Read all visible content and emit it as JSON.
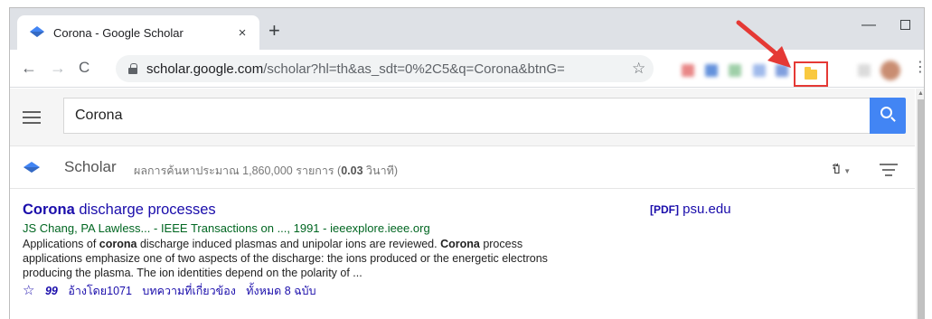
{
  "browser": {
    "tab_title": "Corona - Google Scholar",
    "tab_close": "×",
    "new_tab": "+",
    "url_host": "scholar.google.com",
    "url_path": "/scholar?hl=th&as_sdt=0%2C5&q=Corona&btnG=",
    "back": "←",
    "forward": "→",
    "reload": "C",
    "bookmark": "☆",
    "menu": "⋮",
    "minimize": "—",
    "close": "✕",
    "annotation_color": "#e53935"
  },
  "search": {
    "query": "Corona"
  },
  "scholar": {
    "name": "Scholar",
    "results_prefix": "ผลการค้นหาประมาณ 1,860,000 รายการ (",
    "results_time": "0.03",
    "results_suffix": " วินาที)",
    "year_menu": "ปี"
  },
  "result": {
    "title_bold": "Corona",
    "title_rest": " discharge processes",
    "authors": "JS Chang, PA Lawless... - IEEE Transactions on ..., 1991 - ieeexplore.ieee.org",
    "snippet_1": "Applications of ",
    "snippet_bold_1": "corona",
    "snippet_2": " discharge induced plasmas and unipolar ions are reviewed. ",
    "snippet_bold_2": "Corona",
    "snippet_3": " process applications emphasize one of two aspects of the discharge: the ions produced or the energetic electrons producing the plasma. The ion identities depend on the polarity of ...",
    "links": {
      "save": "☆",
      "cite": "99",
      "cited_by": "อ้างโดย1071",
      "related": "บทความที่เกี่ยวข้อง",
      "versions": "ทั้งหมด 8 ฉบับ"
    },
    "pdf_tag": "[PDF]",
    "pdf_source": "psu.edu"
  }
}
